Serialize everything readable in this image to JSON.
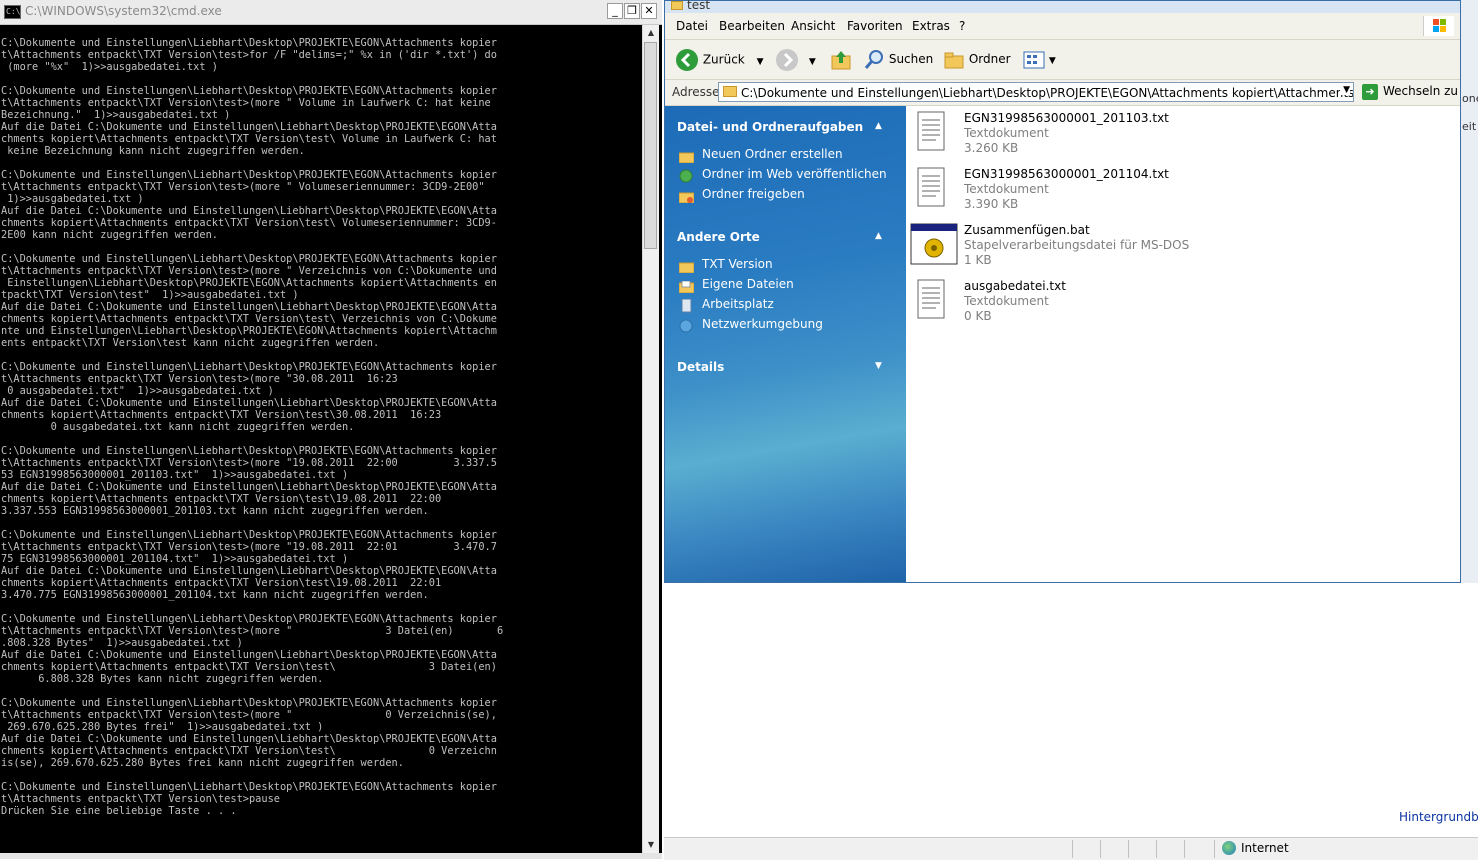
{
  "cmd": {
    "title": "C:\\WINDOWS\\system32\\cmd.exe",
    "icon_text": "C:\\",
    "buttons": {
      "minimize": "_",
      "restore": "❐",
      "close": "✕"
    },
    "lines": [
      "C:\\Dokumente und Einstellungen\\Liebhart\\Desktop\\PROJEKTE\\EGON\\Attachments kopier",
      "t\\Attachments entpackt\\TXT Version\\test>for /F \"delims=;\" %x in ('dir *.txt') do",
      " (more \"%x\"  1)>>ausgabedatei.txt )",
      "",
      "C:\\Dokumente und Einstellungen\\Liebhart\\Desktop\\PROJEKTE\\EGON\\Attachments kopier",
      "t\\Attachments entpackt\\TXT Version\\test>(more \" Volume in Laufwerk C: hat keine",
      "Bezeichnung.\"  1)>>ausgabedatei.txt )",
      "Auf die Datei C:\\Dokumente und Einstellungen\\Liebhart\\Desktop\\PROJEKTE\\EGON\\Atta",
      "chments kopiert\\Attachments entpackt\\TXT Version\\test\\ Volume in Laufwerk C: hat",
      " keine Bezeichnung kann nicht zugegriffen werden.",
      "",
      "C:\\Dokumente und Einstellungen\\Liebhart\\Desktop\\PROJEKTE\\EGON\\Attachments kopier",
      "t\\Attachments entpackt\\TXT Version\\test>(more \" Volumeseriennummer: 3CD9-2E00\"",
      " 1)>>ausgabedatei.txt )",
      "Auf die Datei C:\\Dokumente und Einstellungen\\Liebhart\\Desktop\\PROJEKTE\\EGON\\Atta",
      "chments kopiert\\Attachments entpackt\\TXT Version\\test\\ Volumeseriennummer: 3CD9-",
      "2E00 kann nicht zugegriffen werden.",
      "",
      "C:\\Dokumente und Einstellungen\\Liebhart\\Desktop\\PROJEKTE\\EGON\\Attachments kopier",
      "t\\Attachments entpackt\\TXT Version\\test>(more \" Verzeichnis von C:\\Dokumente und",
      " Einstellungen\\Liebhart\\Desktop\\PROJEKTE\\EGON\\Attachments kopiert\\Attachments en",
      "tpackt\\TXT Version\\test\"  1)>>ausgabedatei.txt )",
      "Auf die Datei C:\\Dokumente und Einstellungen\\Liebhart\\Desktop\\PROJEKTE\\EGON\\Atta",
      "chments kopiert\\Attachments entpackt\\TXT Version\\test\\ Verzeichnis von C:\\Dokume",
      "nte und Einstellungen\\Liebhart\\Desktop\\PROJEKTE\\EGON\\Attachments kopiert\\Attachm",
      "ents entpackt\\TXT Version\\test kann nicht zugegriffen werden.",
      "",
      "C:\\Dokumente und Einstellungen\\Liebhart\\Desktop\\PROJEKTE\\EGON\\Attachments kopier",
      "t\\Attachments entpackt\\TXT Version\\test>(more \"30.08.2011  16:23",
      " 0 ausgabedatei.txt\"  1)>>ausgabedatei.txt )",
      "Auf die Datei C:\\Dokumente und Einstellungen\\Liebhart\\Desktop\\PROJEKTE\\EGON\\Atta",
      "chments kopiert\\Attachments entpackt\\TXT Version\\test\\30.08.2011  16:23",
      "        0 ausgabedatei.txt kann nicht zugegriffen werden.",
      "",
      "C:\\Dokumente und Einstellungen\\Liebhart\\Desktop\\PROJEKTE\\EGON\\Attachments kopier",
      "t\\Attachments entpackt\\TXT Version\\test>(more \"19.08.2011  22:00         3.337.5",
      "53 EGN31998563000001_201103.txt\"  1)>>ausgabedatei.txt )",
      "Auf die Datei C:\\Dokumente und Einstellungen\\Liebhart\\Desktop\\PROJEKTE\\EGON\\Atta",
      "chments kopiert\\Attachments entpackt\\TXT Version\\test\\19.08.2011  22:00",
      "3.337.553 EGN31998563000001_201103.txt kann nicht zugegriffen werden.",
      "",
      "C:\\Dokumente und Einstellungen\\Liebhart\\Desktop\\PROJEKTE\\EGON\\Attachments kopier",
      "t\\Attachments entpackt\\TXT Version\\test>(more \"19.08.2011  22:01         3.470.7",
      "75 EGN31998563000001_201104.txt\"  1)>>ausgabedatei.txt )",
      "Auf die Datei C:\\Dokumente und Einstellungen\\Liebhart\\Desktop\\PROJEKTE\\EGON\\Atta",
      "chments kopiert\\Attachments entpackt\\TXT Version\\test\\19.08.2011  22:01",
      "3.470.775 EGN31998563000001_201104.txt kann nicht zugegriffen werden.",
      "",
      "C:\\Dokumente und Einstellungen\\Liebhart\\Desktop\\PROJEKTE\\EGON\\Attachments kopier",
      "t\\Attachments entpackt\\TXT Version\\test>(more \"               3 Datei(en)       6",
      ".808.328 Bytes\"  1)>>ausgabedatei.txt )",
      "Auf die Datei C:\\Dokumente und Einstellungen\\Liebhart\\Desktop\\PROJEKTE\\EGON\\Atta",
      "chments kopiert\\Attachments entpackt\\TXT Version\\test\\               3 Datei(en)",
      "      6.808.328 Bytes kann nicht zugegriffen werden.",
      "",
      "C:\\Dokumente und Einstellungen\\Liebhart\\Desktop\\PROJEKTE\\EGON\\Attachments kopier",
      "t\\Attachments entpackt\\TXT Version\\test>(more \"               0 Verzeichnis(se),",
      " 269.670.625.280 Bytes frei\"  1)>>ausgabedatei.txt )",
      "Auf die Datei C:\\Dokumente und Einstellungen\\Liebhart\\Desktop\\PROJEKTE\\EGON\\Atta",
      "chments kopiert\\Attachments entpackt\\TXT Version\\test\\               0 Verzeichn",
      "is(se), 269.670.625.280 Bytes frei kann nicht zugegriffen werden.",
      "",
      "C:\\Dokumente und Einstellungen\\Liebhart\\Desktop\\PROJEKTE\\EGON\\Attachments kopier",
      "t\\Attachments entpackt\\TXT Version\\test>pause",
      "Drücken Sie eine beliebige Taste . . ."
    ]
  },
  "explorer": {
    "title": "test",
    "menu": [
      "Datei",
      "Bearbeiten",
      "Ansicht",
      "Favoriten",
      "Extras",
      "?"
    ],
    "toolbar": {
      "back": "Zurück",
      "search": "Suchen",
      "folders": "Ordner"
    },
    "address": {
      "label": "Adresse",
      "value": "C:\\Dokumente und Einstellungen\\Liebhart\\Desktop\\PROJEKTE\\EGON\\Attachments kopiert\\Attachments entpackt\\TXT Version\\test",
      "go": "Wechseln zu"
    },
    "taskpane": {
      "tasks_header": "Datei- und Ordneraufgaben",
      "tasks": [
        "Neuen Ordner erstellen",
        "Ordner im Web veröffentlichen",
        "Ordner freigeben"
      ],
      "places_header": "Andere Orte",
      "places": [
        "TXT Version",
        "Eigene Dateien",
        "Arbeitsplatz",
        "Netzwerkumgebung"
      ],
      "details_header": "Details"
    },
    "files": [
      {
        "name": "EGN31998563000001_201103.txt",
        "type": "Textdokument",
        "size": "3.260 KB",
        "icon": "text-file-icon"
      },
      {
        "name": "EGN31998563000001_201104.txt",
        "type": "Textdokument",
        "size": "3.390 KB",
        "icon": "text-file-icon"
      },
      {
        "name": "Zusammenfügen.bat",
        "type": "Stapelverarbeitungsdatei für MS-DOS",
        "size": "1 KB",
        "icon": "batch-file-icon"
      },
      {
        "name": "ausgabedatei.txt",
        "type": "Textdokument",
        "size": "0 KB",
        "icon": "text-file-icon"
      }
    ]
  },
  "browser": {
    "link": "Hintergrundbil",
    "zone": "Internet",
    "right_fragments": [
      "one",
      "eit ▾"
    ]
  },
  "colors": {
    "console_bg": "#000000",
    "console_text": "#c0c0c0",
    "taskpane_blue": "#1d6bb7"
  }
}
